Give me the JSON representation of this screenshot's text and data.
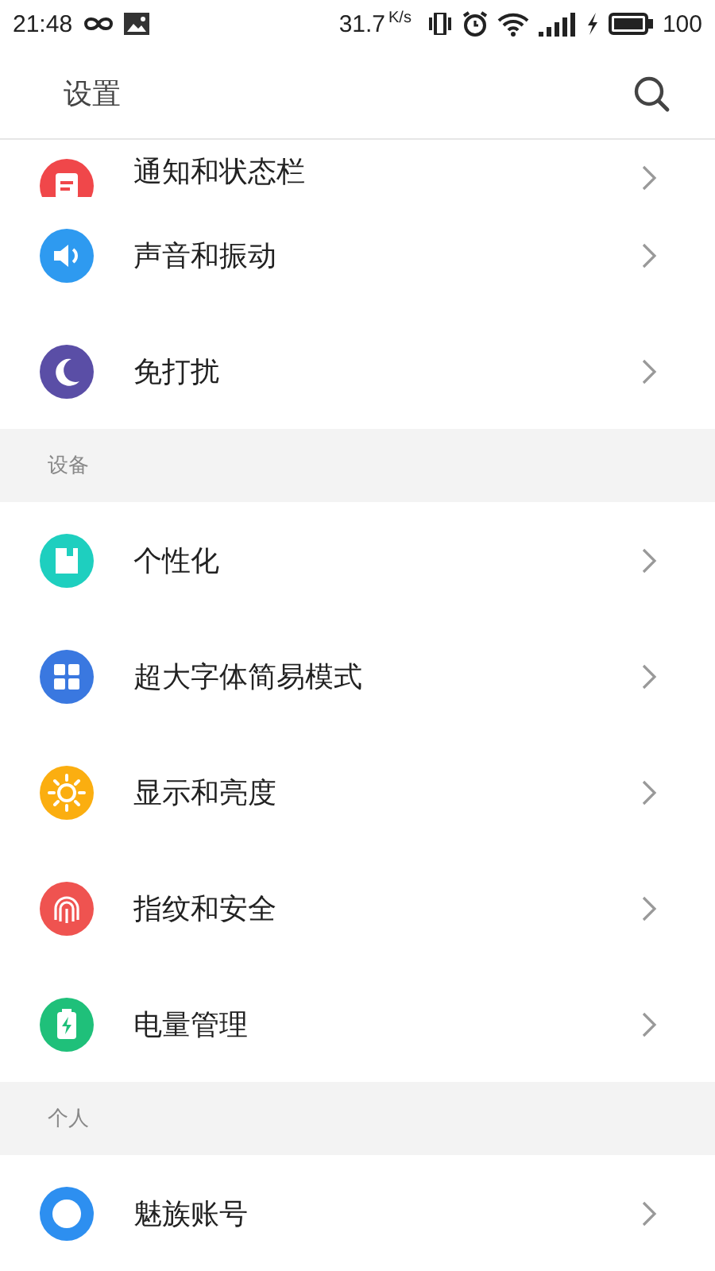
{
  "status_bar": {
    "time": "21:48",
    "speed": "31.7",
    "speed_unit": "K/s",
    "battery": "100"
  },
  "header": {
    "title": "设置"
  },
  "sections": [
    {
      "items": [
        {
          "label": "通知和状态栏",
          "kind": "notice",
          "color": "#f0474a",
          "cut": true
        },
        {
          "label": "声音和振动",
          "kind": "sound",
          "color": "#2e9af0",
          "cut": false
        },
        {
          "label": "免打扰",
          "kind": "moon",
          "color": "#5a4ea6",
          "cut": false
        }
      ]
    },
    {
      "title": "设备",
      "items": [
        {
          "label": "个性化",
          "kind": "theme",
          "color": "#1ecfbf",
          "cut": false
        },
        {
          "label": "超大字体简易模式",
          "kind": "grid",
          "color": "#3a78e0",
          "cut": false
        },
        {
          "label": "显示和亮度",
          "kind": "sun",
          "color": "#fbae10",
          "cut": false
        },
        {
          "label": "指纹和安全",
          "kind": "finger",
          "color": "#ef5350",
          "cut": false
        },
        {
          "label": "电量管理",
          "kind": "battery",
          "color": "#1fc07a",
          "cut": false
        }
      ]
    },
    {
      "title": "个人",
      "items": [
        {
          "label": "魅族账号",
          "kind": "account",
          "color": "#2d8ff0",
          "cut": false
        }
      ]
    }
  ]
}
